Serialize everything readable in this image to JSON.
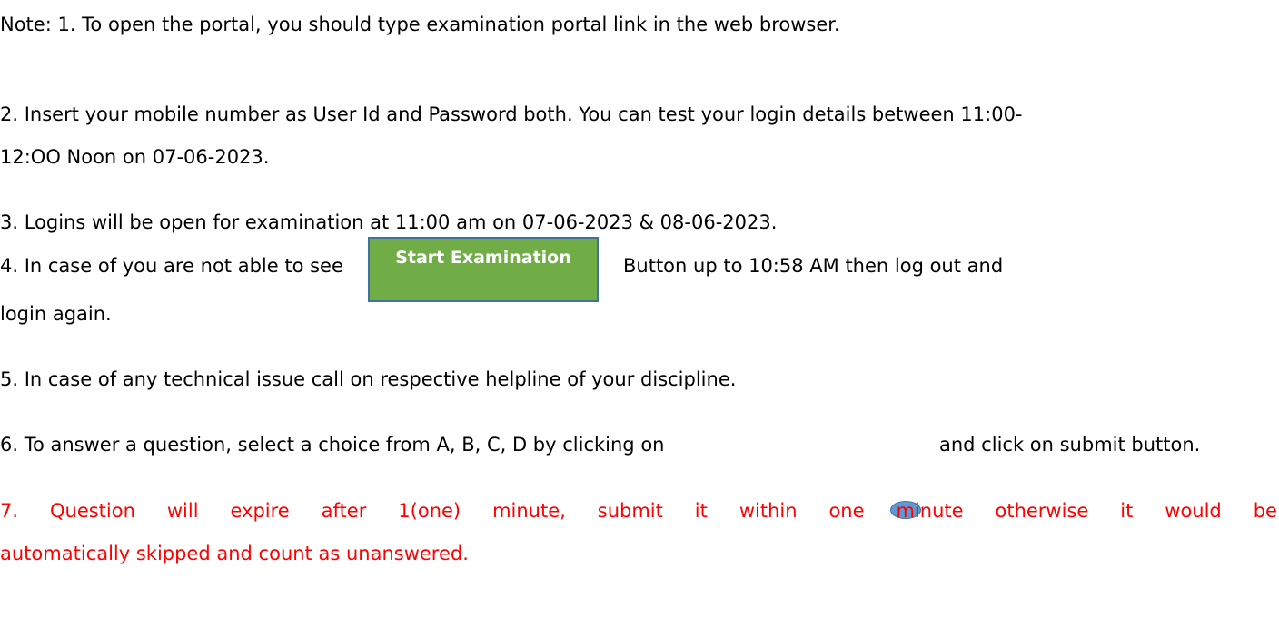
{
  "note": {
    "line1": "Note:  1.  To open the portal, you should type examination portal link in the web browser.",
    "line2a": "2.  Insert your mobile number as User Id and Password both.  You can test your login details between 11:00-",
    "line2b": "12:OO Noon on 07-06-2023.",
    "line3": "3.  Logins will be open for examination at 11:00 am on 07-06-2023 & 08-06-2023.",
    "line4a_before": "4.  In case of you are not able to see",
    "line4a_after": "Button up to 10:58 AM then log out and",
    "line4b": "login again.",
    "line5": "5.  In case of any technical issue call on respective helpline of your discipline.",
    "line6_before": "6.  To answer a question, select a choice from A, B, C, D by clicking on",
    "line6_after": "and click on submit button.",
    "line7_words": [
      "7.",
      "Question",
      "will",
      "expire",
      "after",
      "1(one)",
      "minute,",
      "submit",
      "it",
      "within",
      "one",
      "minute",
      "otherwise",
      "it",
      "would",
      "be"
    ],
    "line7b": "automatically skipped and count as unanswered."
  },
  "start_button": {
    "label": "Start Examination"
  },
  "colors": {
    "button_fill": "#70ad47",
    "button_border": "#41719c",
    "radio_fill": "#5b9bd5",
    "warning_text": "#ff0000"
  },
  "icons": {
    "radio": "radio-circle-icon"
  }
}
